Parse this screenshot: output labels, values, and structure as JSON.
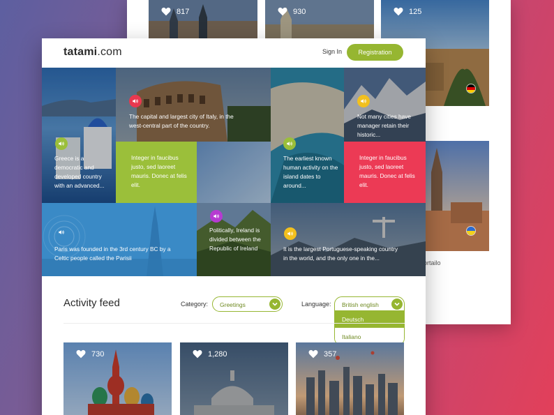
{
  "site": {
    "logo_bold": "tatami",
    "logo_rest": ".com"
  },
  "header": {
    "signin_label": "Sign In",
    "register_label": "Registration"
  },
  "tiles": {
    "italy": "The capital and largest city of Italy, in the west-central part of the country.",
    "greece": "Greece is a democratic and developed country with an advanced...",
    "lorem_green": "Integer in faucibus justo, sed laoreet mauris. Donec at felis elit.",
    "croatia": "The earliest known human activity on the island dates to around...",
    "lorem_red": "Integer in faucibus justo, sed laoreet mauris. Donec at felis elit.",
    "cities": "Not many cities have manager retain their historic...",
    "paris": "Paris was founded in the 3rd century BC by a Celtic people called the Parisii",
    "ireland": "Politically, Ireland is divided between the Republic of Ireland",
    "brazil": "It is the largest Portuguese-speaking country in the world, and the only one in the..."
  },
  "feed": {
    "title": "Activity feed",
    "category_label": "Category:",
    "category_value": "Greetings",
    "language_label": "Language:",
    "language_value": "British english",
    "language_options": [
      "Deutsch",
      "Italiano"
    ],
    "cards": [
      {
        "likes": "730",
        "scene": "moscow"
      },
      {
        "likes": "1,280",
        "scene": "capitol"
      },
      {
        "likes": "357",
        "scene": "skyline"
      }
    ]
  },
  "back_cards": [
    {
      "likes": "817"
    },
    {
      "likes": "930"
    },
    {
      "likes": "125"
    }
  ],
  "back_text": "ortailo",
  "colors": {
    "accent_green": "#96b631",
    "tile_green": "#9bbf3a",
    "tile_red": "#ec3a55",
    "speaker_red": "#e8384f",
    "speaker_yellow": "#f2c01e",
    "speaker_purple": "#b63bd1"
  },
  "icons": {
    "like": "heart-icon",
    "audio": "speaker-icon",
    "dropdown": "chevron-down-icon"
  }
}
